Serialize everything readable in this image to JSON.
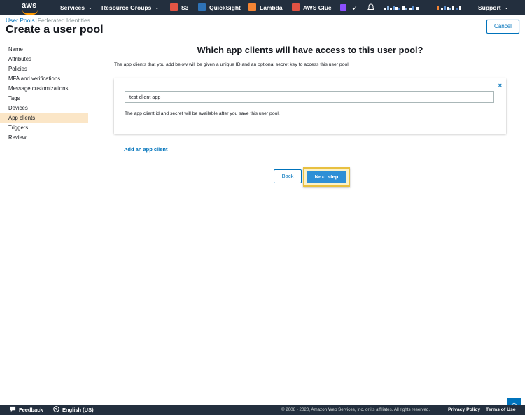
{
  "topnav": {
    "logo": "aws",
    "services": "Services",
    "resource_groups": "Resource Groups",
    "pins": [
      {
        "label": "S3",
        "color": "#e25444"
      },
      {
        "label": "QuickSight",
        "color": "#2e73b8"
      },
      {
        "label": "Lambda",
        "color": "#f58534"
      },
      {
        "label": "AWS Glue",
        "color": "#e05243"
      }
    ],
    "support": "Support"
  },
  "header": {
    "breadcrumb_user_pools": "User Pools",
    "breadcrumb_separator": "|",
    "breadcrumb_federated": "Federated Identities",
    "title": "Create a user pool",
    "cancel": "Cancel"
  },
  "sidebar": {
    "items": [
      {
        "label": "Name"
      },
      {
        "label": "Attributes"
      },
      {
        "label": "Policies"
      },
      {
        "label": "MFA and verifications"
      },
      {
        "label": "Message customizations"
      },
      {
        "label": "Tags"
      },
      {
        "label": "Devices"
      },
      {
        "label": "App clients",
        "active": true
      },
      {
        "label": "Triggers"
      },
      {
        "label": "Review"
      }
    ]
  },
  "main": {
    "title": "Which app clients will have access to this user pool?",
    "description": "The app clients that you add below will be given a unique ID and an optional secret key to access this user pool.",
    "client": {
      "name_value": "test client app",
      "note": "The app client id and secret will be available after you save this user pool.",
      "close_icon": "×"
    },
    "add_client": "Add an app client",
    "back": "Back",
    "next": "Next step"
  },
  "footer": {
    "feedback": "Feedback",
    "language": "English (US)",
    "copyright": "© 2008 - 2020, Amazon Web Services, Inc. or its affiliates. All rights reserved.",
    "privacy": "Privacy Policy",
    "terms": "Terms of Use"
  },
  "colors": {
    "nav_bg": "#232f3e",
    "link": "#0073bb",
    "primary": "#2e8fd6",
    "active_bg": "#fbe6c7",
    "highlight": "#e8c040"
  }
}
